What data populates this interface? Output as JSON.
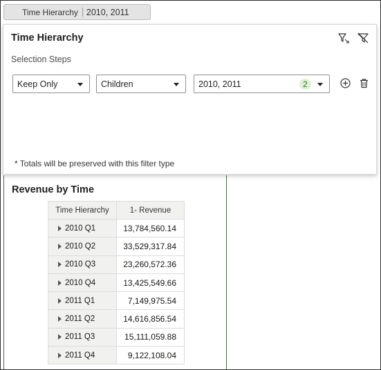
{
  "filter_pill": {
    "label": "Time Hierarchy",
    "value": "2010, 2011"
  },
  "panel": {
    "title": "Time Hierarchy",
    "steps_label": "Selection Steps",
    "operation_select": "Keep Only",
    "method_select": "Children",
    "members_select": "2010, 2011",
    "members_count": "2",
    "footnote": "* Totals will be preserved with this filter type",
    "icons": [
      "filter-edit-icon",
      "clear-filter-icon",
      "add-circle-icon",
      "trash-icon"
    ]
  },
  "view": {
    "title": "Revenue by Time",
    "columns": [
      "Time Hierarchy",
      "1- Revenue"
    ],
    "rows": [
      {
        "label": "2010 Q1",
        "value": "13,784,560.14"
      },
      {
        "label": "2010 Q2",
        "value": "33,529,317.84"
      },
      {
        "label": "2010 Q3",
        "value": "23,260,572.36"
      },
      {
        "label": "2010 Q4",
        "value": "13,425,549.66"
      },
      {
        "label": "2011 Q1",
        "value": "7,149,975.54"
      },
      {
        "label": "2011 Q2",
        "value": "14,616,856.54"
      },
      {
        "label": "2011 Q3",
        "value": "15,111,059.88"
      },
      {
        "label": "2011 Q4",
        "value": "9,122,108.04"
      }
    ]
  },
  "colors": {
    "badge_bg": "#dff0d8",
    "view_border": "#3f6b3f"
  }
}
